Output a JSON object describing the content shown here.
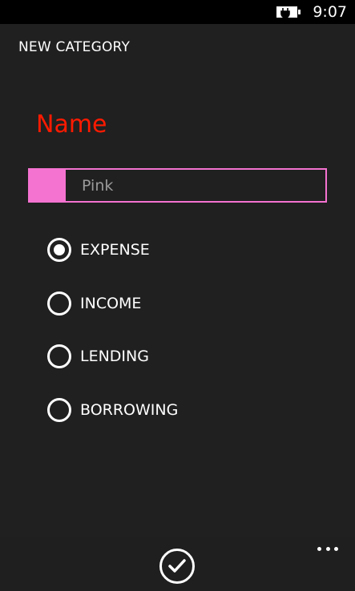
{
  "status_bar": {
    "time": "9:07",
    "battery_icon": "battery-charging-icon"
  },
  "page": {
    "title": "NEW CATEGORY",
    "name_label": "Name",
    "name_value": "Pink",
    "accent_color": "#f472d0",
    "label_color": "#ff1a00"
  },
  "category_type": {
    "selected": "EXPENSE",
    "options": [
      {
        "label": "EXPENSE",
        "checked": true
      },
      {
        "label": "INCOME",
        "checked": false
      },
      {
        "label": "LENDING",
        "checked": false
      },
      {
        "label": "BORROWING",
        "checked": false
      }
    ]
  },
  "app_bar": {
    "confirm_icon": "checkmark-icon",
    "more_icon": "ellipsis-icon"
  }
}
